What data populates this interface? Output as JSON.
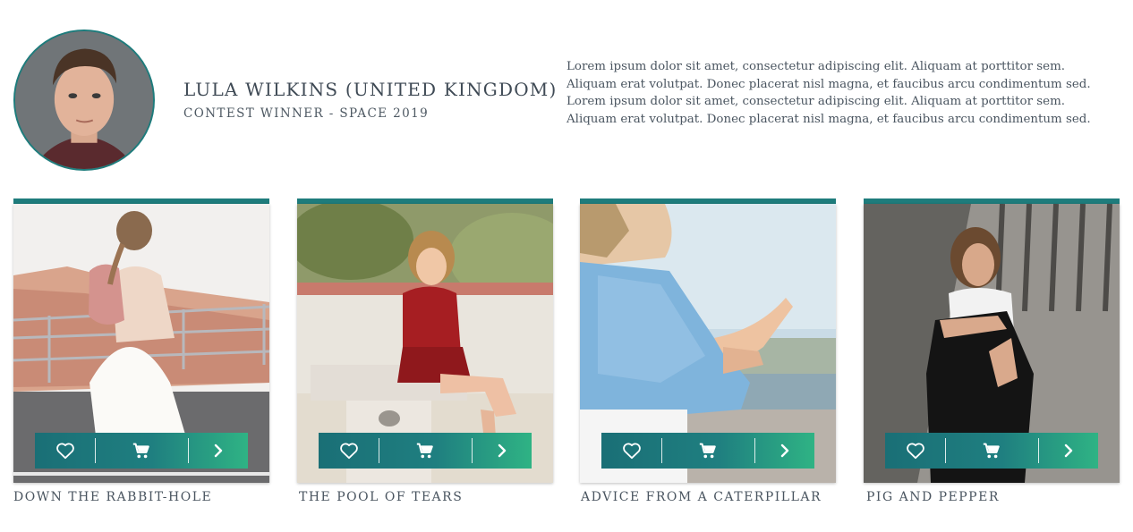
{
  "profile": {
    "name": "LULA WILKINS (UNITED KINGDOM)",
    "subtitle": "CONTEST WINNER - SPACE 2019",
    "bio": "Lorem ipsum dolor sit amet, consectetur adipiscing elit. Aliquam at porttitor sem.  Aliquam erat volutpat. Donec placerat nisl magna, et faucibus arcu condimentum sed. Lorem ipsum dolor sit amet, consectetur adipiscing elit. Aliquam at porttitor sem.  Aliquam erat volutpat. Donec placerat nisl magna, et faucibus arcu condimentum sed."
  },
  "theme": {
    "accent": "#1e7c7c",
    "gradient_start": "#1a6f76",
    "gradient_end": "#2fb384"
  },
  "cards": [
    {
      "caption": "DOWN THE RABBIT-HOLE",
      "icons": [
        "heart-icon",
        "cart-icon",
        "chevron-right-icon"
      ]
    },
    {
      "caption": "THE POOL OF TEARS",
      "icons": [
        "heart-icon",
        "cart-icon",
        "chevron-right-icon"
      ]
    },
    {
      "caption": "ADVICE FROM A CATERPILLAR",
      "icons": [
        "heart-icon",
        "cart-icon",
        "chevron-right-icon"
      ]
    },
    {
      "caption": "PIG AND PEPPER",
      "icons": [
        "heart-icon",
        "cart-icon",
        "chevron-right-icon"
      ]
    }
  ]
}
